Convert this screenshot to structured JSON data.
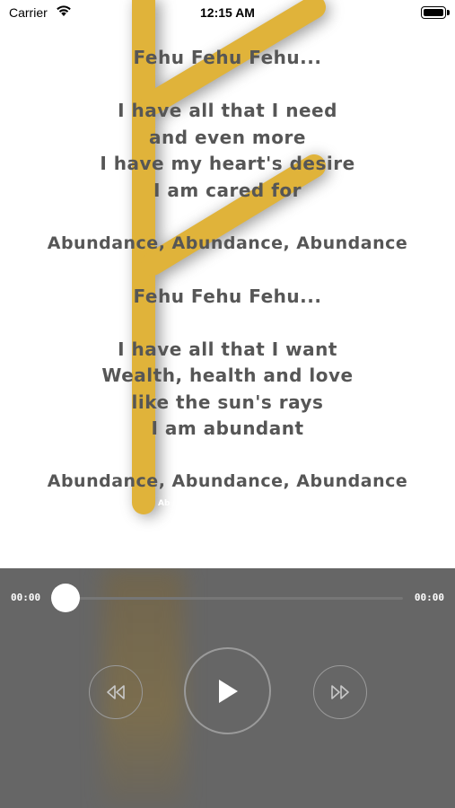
{
  "status_bar": {
    "carrier": "Carrier",
    "time": "12:15 AM",
    "wifi_icon": "wifi-icon",
    "battery_icon": "battery-icon"
  },
  "artwork": {
    "icon": "fehu-rune-icon",
    "color": "#e0b33a"
  },
  "lyrics": [
    "Fehu Fehu Fehu...",
    "",
    "I have all that I need",
    "and even more",
    "I have my heart's desire",
    "I am cared for",
    "",
    "Abundance, Abundance, Abundance",
    "",
    "Fehu Fehu Fehu...",
    "",
    "I have all that I want",
    "Wealth, health and love",
    "like the sun's rays",
    "I am abundant",
    "",
    "Abundance, Abundance, Abundance"
  ],
  "caption": "Ab",
  "player": {
    "elapsed": "00:00",
    "duration": "00:00",
    "progress": 0,
    "rewind_icon": "rewind-icon",
    "play_icon": "play-icon",
    "fast_forward_icon": "fast-forward-icon",
    "background": "#666666"
  }
}
